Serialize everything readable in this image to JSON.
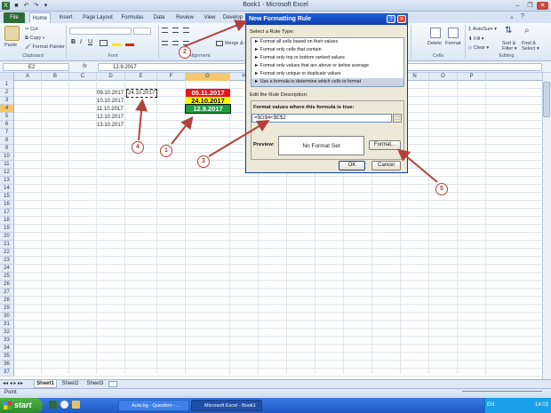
{
  "window": {
    "title": "Book1 - Microsoft Excel"
  },
  "ribbon": {
    "tabs": [
      "File",
      "Home",
      "Insert",
      "Page Layout",
      "Formulas",
      "Data",
      "Review",
      "View",
      "Develop"
    ],
    "clipboard": {
      "paste": "Paste",
      "cut": "Cut",
      "copy": "Copy ▾",
      "format_painter": "Format Painter",
      "group": "Clipboard"
    },
    "font_group": "Font",
    "alignment": {
      "merge": "Merge & C",
      "group": "Alignment"
    },
    "cells": {
      "delete": "Delete",
      "format": "Format",
      "group": "Cells"
    },
    "editing": {
      "autosum": "AutoSum ▾",
      "fill": "Fill ▾",
      "clear": "Clear ▾",
      "sort": "Sort & Filter ▾",
      "find": "Find & Select ▾",
      "group": "Editing"
    }
  },
  "formula_bar": {
    "name_box": "E2",
    "fx": "fx",
    "value": "12.9.2017"
  },
  "grid": {
    "columns": [
      "A",
      "B",
      "C",
      "D",
      "E",
      "F",
      "G",
      "H",
      "I",
      "J",
      "K",
      "L",
      "M",
      "N",
      "O",
      "P"
    ],
    "rows": [
      "1",
      "2",
      "3",
      "4",
      "5",
      "6",
      "7",
      "8",
      "9",
      "10",
      "11",
      "12",
      "13",
      "14",
      "15",
      "16",
      "17",
      "18",
      "19",
      "20",
      "21",
      "22",
      "23",
      "24",
      "25",
      "26",
      "27",
      "28",
      "29",
      "30",
      "31",
      "32",
      "33",
      "34",
      "35",
      "36",
      "37"
    ],
    "d_dates": [
      "09.10.2017",
      "10.10.2017",
      "11.10.2017",
      "12.10.2017",
      "13.10.2017"
    ],
    "e2": "24.10.2017",
    "g_values": [
      {
        "text": "05.11.2017",
        "bg": "#e8141c",
        "fg": "#ffffff"
      },
      {
        "text": "24.10.2017",
        "bg": "#ffff00",
        "fg": "#000000"
      },
      {
        "text": "12.9.2017",
        "bg": "#1f9e3e",
        "fg": "#ffffff"
      }
    ]
  },
  "sheets": {
    "tabs": [
      "Sheet1",
      "Sheet2",
      "Sheet3"
    ],
    "status": "Point"
  },
  "dialog": {
    "title": "New Formatting Rule",
    "help": "?",
    "close": "✕",
    "select_label": "Select a Rule Type:",
    "rule_types": [
      "► Format all cells based on their values",
      "► Format only cells that contain",
      "► Format only top or bottom ranked values",
      "► Format only values that are above or below average",
      "► Format only unique or duplicate values",
      "► Use a formula to determine which cells to format"
    ],
    "edit_label": "Edit the Rule Description:",
    "formula_label": "Format values where this formula is true:",
    "formula": "=$G$4<$E$2",
    "preview_label": "Preview:",
    "preview_text": "No Format Set",
    "format_button": "Format...",
    "ok": "OK",
    "cancel": "Cancel"
  },
  "annotations": [
    "1",
    "2",
    "3",
    "4",
    "5"
  ],
  "taskbar": {
    "start": "start",
    "tasks": [
      "Aula.bg - Question - ...",
      "Microsoft Excel - Book1"
    ],
    "lang": "EN",
    "clock": "14:03"
  },
  "colors": {
    "accent": "#b3403a",
    "dialog_title": "#1f5fd8",
    "selected_col": "#f5c66b"
  }
}
